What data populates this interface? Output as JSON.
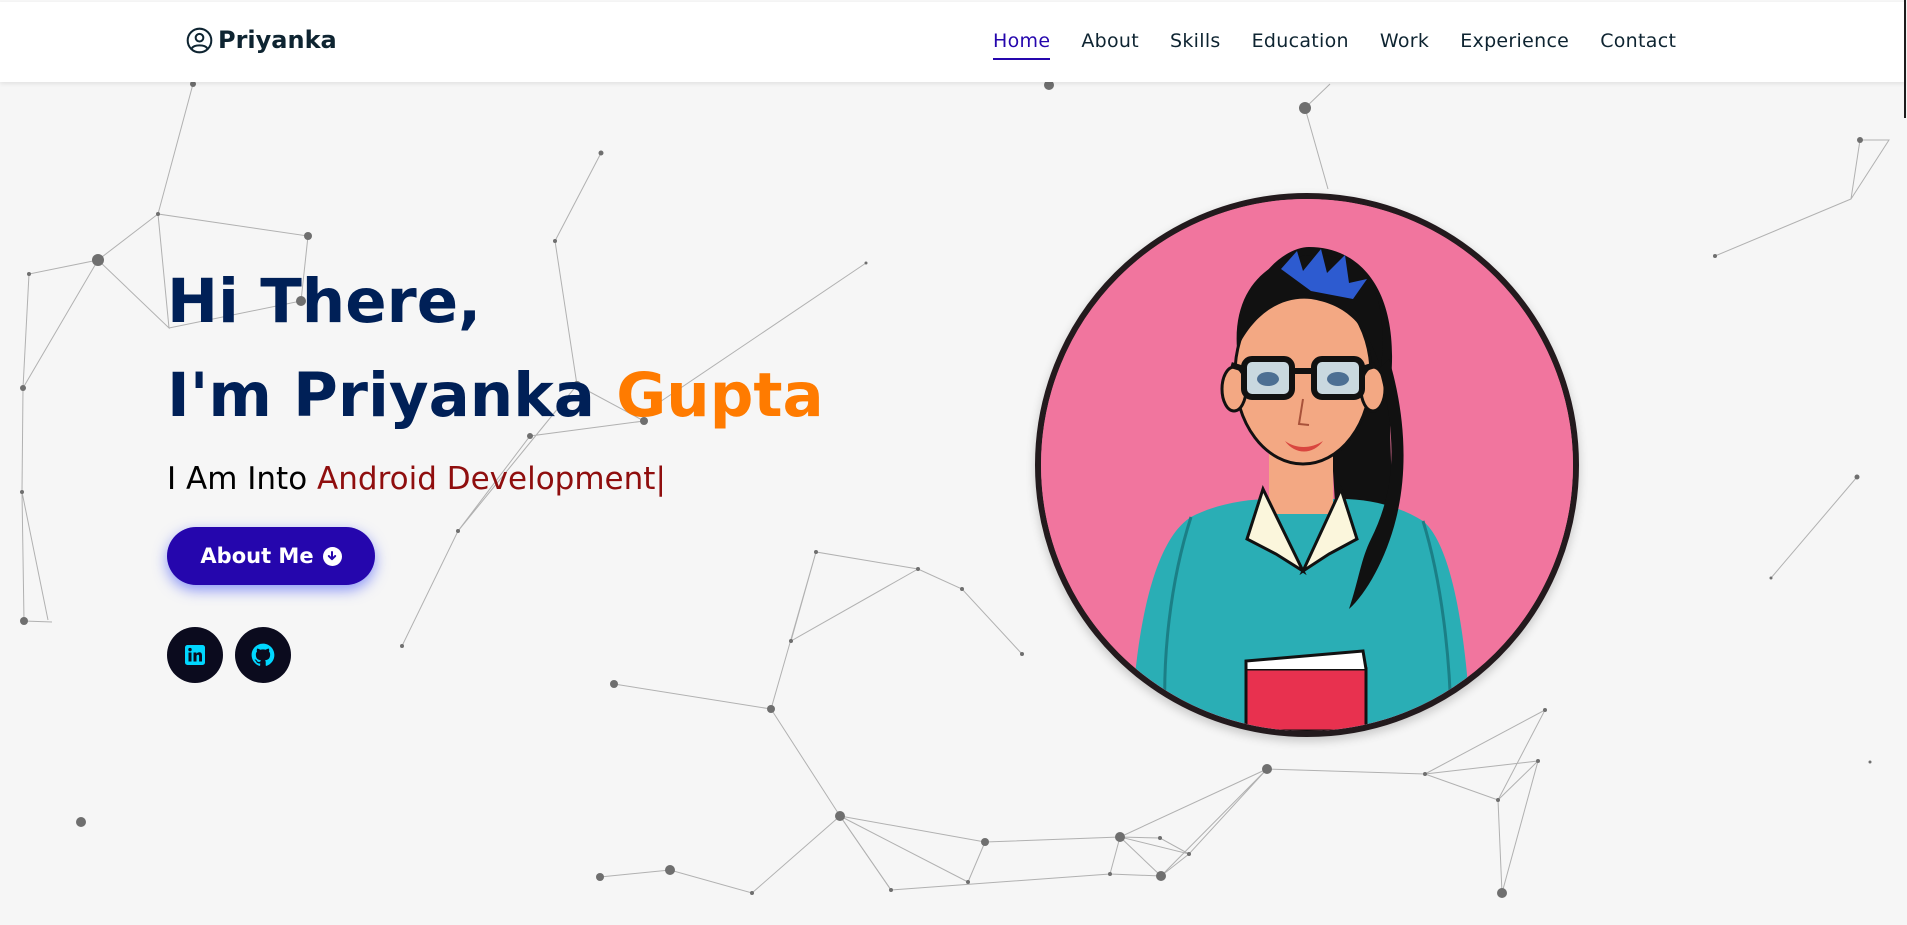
{
  "header": {
    "brand": "Priyanka",
    "nav": [
      {
        "label": "Home",
        "active": true
      },
      {
        "label": "About"
      },
      {
        "label": "Skills"
      },
      {
        "label": "Education"
      },
      {
        "label": "Work"
      },
      {
        "label": "Experience"
      },
      {
        "label": "Contact"
      }
    ]
  },
  "hero": {
    "line1": "Hi There,",
    "line2_first": "I'm Priyanka",
    "line2_last": "Gupta",
    "typing_prefix": "I Am Into",
    "typing_value": "Android Development",
    "cursor": "|",
    "button_label": "About Me"
  },
  "socials": [
    {
      "icon": "linkedin-icon"
    },
    {
      "icon": "github-icon"
    }
  ],
  "colors": {
    "primary": "#2506ad",
    "heading": "#002057",
    "accent": "#ff7b00",
    "typed": "#8f0e0e",
    "portrait_bg": "#f1759e",
    "social_icon": "#00d7ff"
  }
}
